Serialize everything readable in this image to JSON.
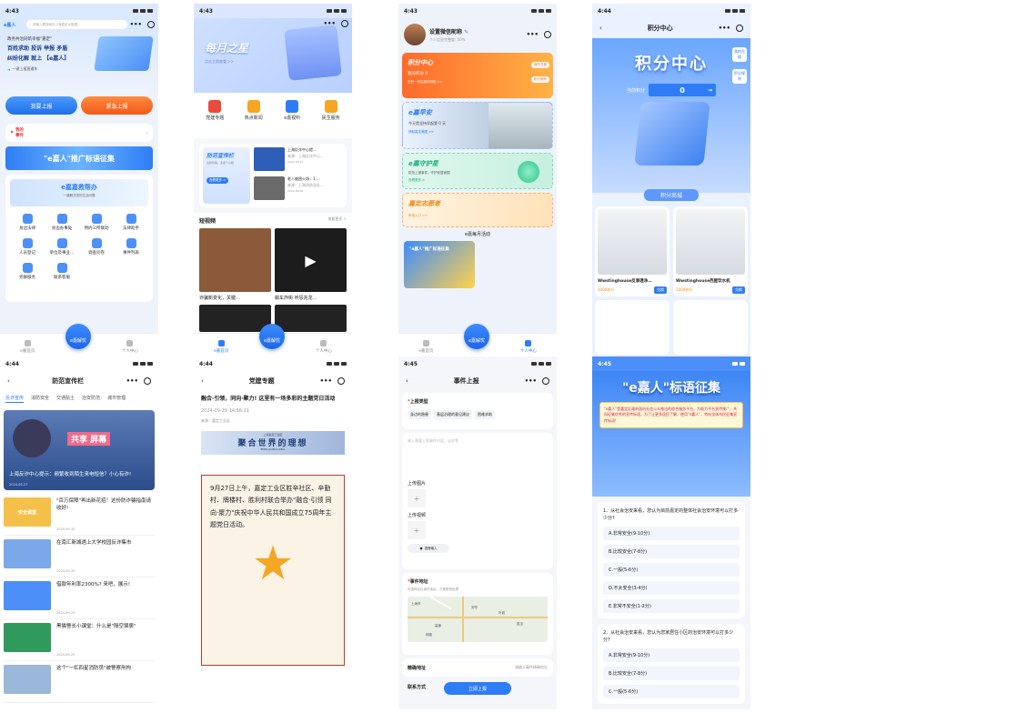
{
  "common": {
    "time1": "4:43",
    "time2": "4:44",
    "time3": "4:45"
  },
  "f1": {
    "logo": "e嘉人",
    "search_placeholder": "请输入要搜索的上海嘉定大数据…",
    "banner_l1": "政务共治同筑幸福\"嘉定\"",
    "banner_l2": "百姓求助 投诉 举报 矛盾",
    "banner_l3": "纠纷化解 就上 【e嘉人】",
    "banner_sub": "一键上报直通车",
    "btn_report": "我要上报",
    "btn_urgent": "紧急上报",
    "my_events_a": "我的",
    "my_events_b": "事件",
    "slogan_banner": "\"e嘉人\"推广标语征集",
    "help_title": "e嘉嘉救帮办",
    "help_sub": "一键解决您的生活问题",
    "services": [
      "身边法律",
      "身边办事处",
      "预约三所联动",
      "法律助手",
      "人员登记",
      "单位及事业…",
      "调查问卷",
      "事件列表",
      "党群服务",
      "联系客服"
    ],
    "tab_home": "e嘉首页",
    "tab_center": "e嘉解忧",
    "tab_me": "个人中心"
  },
  "f2": {
    "hero_title": "每月之星",
    "hero_sub": "点击立即查看 >>",
    "menu": [
      "党建专题",
      "热点新闻",
      "e嘉视听",
      "民生服务"
    ],
    "promo_title": "防范宣传栏",
    "promo_sub": "最新防骗，多留个心眼",
    "promo_more": "查看更多 >",
    "news": [
      {
        "title": "上海反诈中心提…",
        "source": "来源：上海反诈中心…",
        "date": "2024-09-27"
      },
      {
        "title": "老人被困火场，1…",
        "source": "来源：上海消防总队…",
        "date": "2024-09-05"
      }
    ],
    "video_title": "短视频",
    "video_more": "查看更多 >",
    "videos": [
      "诈骗新变化，关键…",
      "飙车炸街 听惩兆龙…"
    ],
    "tab_home": "e嘉首页",
    "tab_center": "e嘉解忧",
    "tab_me": "个人中心"
  },
  "f3": {
    "nickname": "设置微信昵称",
    "profile_pct": "个人信息完整度: 50%",
    "points_title": "积分中心",
    "my_points": "我的积分 0",
    "points_hint": "您有一份高级待领取 >>",
    "my_exchange": "我的兑换",
    "points_rule": "积分规则",
    "safe_title": "e嘉早安",
    "safe_text": "今天是坚持早起第 0 天",
    "safe_link": "获取嘉定美图 >>",
    "guard_title": "e嘉守护星",
    "guard_text": "防范上报事件，守护安居家园",
    "guard_link": "查看更多 >",
    "volunteer_title": "嘉定志愿者",
    "volunteer_link": "申请入口 >>",
    "monthly": "e嘉每月活动",
    "activity_text": "\"e嘉人\"推广标语征集",
    "tab_home": "e嘉首页",
    "tab_center": "e嘉解忧",
    "tab_me": "个人中心"
  },
  "f4": {
    "title": "积分中心",
    "hero": "积分中心",
    "side1": "我的兑换",
    "side2": "积分规则",
    "current_label": "当前积分",
    "current_value": "0",
    "mall": "积分商城",
    "products": [
      {
        "name": "Wwstinghouse反渗透净…",
        "points": "2000积分",
        "btn": "兑换"
      },
      {
        "name": "Wwstinghouse西屋饮水机",
        "points": "1000积分",
        "btn": "兑换"
      }
    ]
  },
  "f5": {
    "time": "4:44",
    "title": "防范宣传栏",
    "tabs": [
      "反诈宣传",
      "消防安全",
      "交通贴士",
      "治安防范",
      "城市管理"
    ],
    "hero_title": "上海反诈中心提示：频繁收到陌生来电短信？小心有诈!",
    "hero_date": "2024-09-27",
    "hero_banner": "共享 屏幕",
    "items": [
      {
        "title": "\"百万保障\"再出新花招！这份防诈骗指南请收好!",
        "date": "2024-09-30",
        "thumb": "安全课堂"
      },
      {
        "title": "在南汇新城遇上大学校园反诈集市",
        "date": "2024-09-30",
        "thumb": ""
      },
      {
        "title": "借款年利率2300%? 来吧，展示!",
        "date": "2024-09-25",
        "thumb": ""
      },
      {
        "title": "黑猫警长小课堂：什么是\"隔空猥亵\"",
        "date": "2024-09-25",
        "thumb": ""
      },
      {
        "title": "这个\"一杠四星消防员\"被警察刑拘",
        "date": "",
        "thumb": ""
      }
    ]
  },
  "f6": {
    "time": "4:44",
    "title": "党建专题",
    "article_title": "融合·引领，同向·聚力! 这里有一场多彩的主题党日活动",
    "article_date": "2024-09-29 14:56:21",
    "article_source": "来源：嘉定工业区",
    "banner_top": "上海嘉定工业区",
    "banner_main": "聚合世界的理想",
    "banner_en": "BEING GLOBAL IDEAL",
    "body": "9月27日上午，嘉定工业区胜辛社区、辛勤村、牌楼村、胜利村联合举办\"融合·引领 同向·聚力\"庆祝中华人民共和国成立75周年主题党日活动。"
  },
  "f7": {
    "time": "4:45",
    "title": "事件上报",
    "type_label": "上报类型",
    "types": [
      "身边的隐患",
      "基层治理的意见建议",
      "困难求助"
    ],
    "content_placeholder": "输入需要上报事件内容，谈求等",
    "upload_img": "上传图片",
    "upload_video": "上传视频",
    "voice": "语音输入",
    "addr_label": "事件地址",
    "addr_hint": "可选择定位事件地址，方便更快处理",
    "map_labels": [
      "上海市",
      "高速",
      "安亭",
      "叶城",
      "胜泾",
      "杨路"
    ],
    "precise_label": "精确地址",
    "precise_placeholder": "请输入事件精确地址",
    "contact_label": "联系方式",
    "submit": "立即上报"
  },
  "f8": {
    "time": "4:45",
    "hero_title": "\"e嘉人\"标语征集",
    "hero_text": "\"e嘉人\"是嘉定区政府面向社会公众推出的综合服务平台，为助力平台宣传推广，共同征集优秀的宣传标语，为了让更多居民了解，使用\"e嘉人\"，特向全体市民征集宣传标语!",
    "questions": [
      {
        "q": "1、从社会治安来看，您认为目前嘉定的整体社会治安环境可以打多少分?",
        "opts": [
          "A.非常安全(9-10分)",
          "B.比较安全(7-8分)",
          "C.一般(5-6分)",
          "D.不太安全(3-4分)",
          "E.非常不安全(1-2分)"
        ]
      },
      {
        "q": "2、从社会治安来看，您认为您家居住小区的治安环境可以打多少分?",
        "opts": [
          "A.非常安全(9-10分)",
          "B.比较安全(7-8分)",
          "C.一般(5-6分)"
        ]
      }
    ]
  }
}
